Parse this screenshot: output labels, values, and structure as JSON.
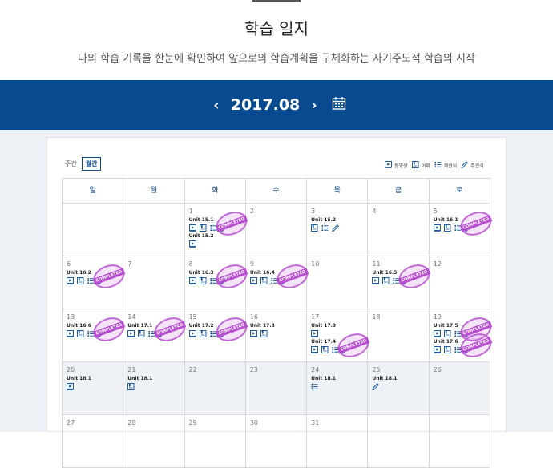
{
  "header": {
    "title": "학습 일지",
    "subtitle": "나의 학습 기록을 한눈에 확인하여 앞으로의 학습계획을 구체화하는 자기주도적 학습의 시작"
  },
  "nav": {
    "prev": "‹",
    "next": "›",
    "month": "2017.08"
  },
  "view_tabs": {
    "week": "주간",
    "month": "월간"
  },
  "legend": [
    {
      "icon": "video-icon",
      "label": "동영상"
    },
    {
      "icon": "vocab-icon",
      "label": "어휘"
    },
    {
      "icon": "quiz-icon",
      "label": "객관식"
    },
    {
      "icon": "pencil-icon",
      "label": "주관식"
    }
  ],
  "stamp_text": "COMPLETED",
  "weekdays": [
    "일",
    "월",
    "화",
    "수",
    "목",
    "금",
    "토"
  ],
  "colors": {
    "accent": "#084a8f",
    "stamp": "#c267d8"
  },
  "weeks": [
    [
      {
        "day": "",
        "entries": []
      },
      {
        "day": "",
        "entries": []
      },
      {
        "day": "1",
        "entries": [
          {
            "unit": "Unit 15.1",
            "icons": [
              "video-icon",
              "vocab-icon",
              "quiz-icon",
              "pencil-icon"
            ],
            "completed": true
          },
          {
            "unit": "Unit 15.2",
            "icons": [
              "video-icon"
            ],
            "completed": false
          }
        ]
      },
      {
        "day": "2",
        "entries": []
      },
      {
        "day": "3",
        "entries": [
          {
            "unit": "Unit 15.2",
            "icons": [
              "vocab-icon",
              "quiz-icon",
              "pencil-icon"
            ],
            "completed": false
          }
        ]
      },
      {
        "day": "4",
        "entries": []
      },
      {
        "day": "5",
        "entries": [
          {
            "unit": "Unit 16.1",
            "icons": [
              "video-icon",
              "vocab-icon",
              "quiz-icon",
              "pencil-icon"
            ],
            "completed": true
          }
        ]
      }
    ],
    [
      {
        "day": "6",
        "entries": [
          {
            "unit": "Unit 16.2",
            "icons": [
              "video-icon",
              "vocab-icon",
              "quiz-icon",
              "pencil-icon"
            ],
            "completed": true
          }
        ]
      },
      {
        "day": "7",
        "entries": []
      },
      {
        "day": "8",
        "entries": [
          {
            "unit": "Unit 16.3",
            "icons": [
              "video-icon",
              "vocab-icon",
              "quiz-icon",
              "pencil-icon"
            ],
            "completed": true
          }
        ]
      },
      {
        "day": "9",
        "entries": [
          {
            "unit": "Unit 16.4",
            "icons": [
              "video-icon",
              "vocab-icon",
              "quiz-icon",
              "pencil-icon"
            ],
            "completed": true
          }
        ]
      },
      {
        "day": "10",
        "entries": []
      },
      {
        "day": "11",
        "entries": [
          {
            "unit": "Unit 16.5",
            "icons": [
              "video-icon",
              "vocab-icon",
              "quiz-icon",
              "pencil-icon"
            ],
            "completed": true
          }
        ]
      },
      {
        "day": "12",
        "entries": []
      }
    ],
    [
      {
        "day": "13",
        "entries": [
          {
            "unit": "Unit 16.6",
            "icons": [
              "video-icon",
              "vocab-icon",
              "quiz-icon",
              "pencil-icon"
            ],
            "completed": true
          }
        ]
      },
      {
        "day": "14",
        "entries": [
          {
            "unit": "Unit 17.1",
            "icons": [
              "video-icon",
              "vocab-icon",
              "quiz-icon",
              "pencil-icon"
            ],
            "completed": true
          }
        ]
      },
      {
        "day": "15",
        "entries": [
          {
            "unit": "Unit 17.2",
            "icons": [
              "video-icon",
              "vocab-icon",
              "quiz-icon",
              "pencil-icon"
            ],
            "completed": true
          }
        ]
      },
      {
        "day": "16",
        "entries": [
          {
            "unit": "Unit 17.3",
            "icons": [
              "video-icon",
              "vocab-icon"
            ],
            "completed": false
          }
        ]
      },
      {
        "day": "17",
        "entries": [
          {
            "unit": "Unit 17.3",
            "icons": [
              "video-icon"
            ],
            "completed": false
          },
          {
            "unit": "Unit 17.4",
            "icons": [
              "video-icon",
              "vocab-icon",
              "quiz-icon",
              "pencil-icon"
            ],
            "completed": true
          }
        ]
      },
      {
        "day": "18",
        "entries": []
      },
      {
        "day": "19",
        "entries": [
          {
            "unit": "Unit 17.5",
            "icons": [
              "video-icon",
              "vocab-icon",
              "quiz-icon",
              "pencil-icon"
            ],
            "completed": true
          },
          {
            "unit": "Unit 17.6",
            "icons": [
              "video-icon",
              "vocab-icon",
              "quiz-icon",
              "pencil-icon"
            ],
            "completed": true
          }
        ]
      }
    ],
    [
      {
        "day": "20",
        "shade": true,
        "entries": [
          {
            "unit": "Unit 18.1",
            "icons": [
              "video-icon"
            ],
            "completed": false
          }
        ]
      },
      {
        "day": "21",
        "shade": true,
        "entries": [
          {
            "unit": "Unit 18.1",
            "icons": [
              "vocab-icon"
            ],
            "completed": false
          }
        ]
      },
      {
        "day": "22",
        "shade": true,
        "entries": []
      },
      {
        "day": "23",
        "shade": true,
        "entries": []
      },
      {
        "day": "24",
        "shade": true,
        "entries": [
          {
            "unit": "Unit 18.1",
            "icons": [
              "quiz-icon"
            ],
            "completed": false
          }
        ]
      },
      {
        "day": "25",
        "shade": true,
        "entries": [
          {
            "unit": "Unit 18.1",
            "icons": [
              "pencil-icon"
            ],
            "completed": false
          }
        ]
      },
      {
        "day": "26",
        "shade": true,
        "entries": []
      }
    ],
    [
      {
        "day": "27",
        "entries": []
      },
      {
        "day": "28",
        "entries": []
      },
      {
        "day": "29",
        "entries": []
      },
      {
        "day": "30",
        "entries": []
      },
      {
        "day": "31",
        "entries": []
      },
      {
        "day": "",
        "entries": []
      },
      {
        "day": "",
        "entries": []
      }
    ]
  ]
}
